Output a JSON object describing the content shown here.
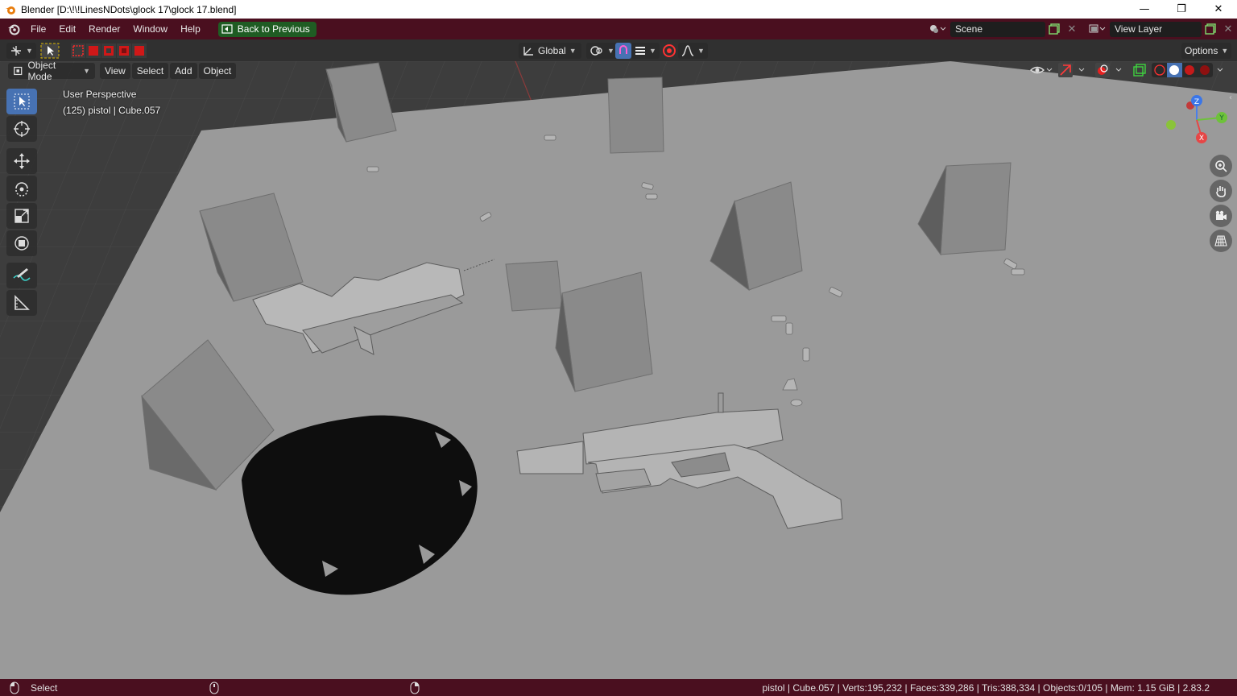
{
  "window": {
    "title": "Blender [D:\\!\\!LinesNDots\\glock 17\\glock 17.blend]"
  },
  "menu": {
    "items": [
      "File",
      "Edit",
      "Render",
      "Window",
      "Help"
    ],
    "back_label": "Back to Previous"
  },
  "scene": {
    "name": "Scene",
    "view_layer": "View Layer"
  },
  "toolbar": {
    "orientation": "Global",
    "options": "Options"
  },
  "viewport": {
    "mode": "Object Mode",
    "menus": [
      "View",
      "Select",
      "Add",
      "Object"
    ],
    "perspective": "User Perspective",
    "info": "(125) pistol | Cube.057"
  },
  "gizmo": {
    "z": "Z",
    "y": "Y",
    "x": "X"
  },
  "status": {
    "left": "Select",
    "right": "pistol | Cube.057 | Verts:195,232 | Faces:339,286 | Tris:388,334 | Objects:0/105 | Mem: 1.15 GiB | 2.83.2"
  },
  "colors": {
    "topbar": "#4a0f1f",
    "accent": "#4772b3",
    "back_button": "#1f5c23"
  }
}
